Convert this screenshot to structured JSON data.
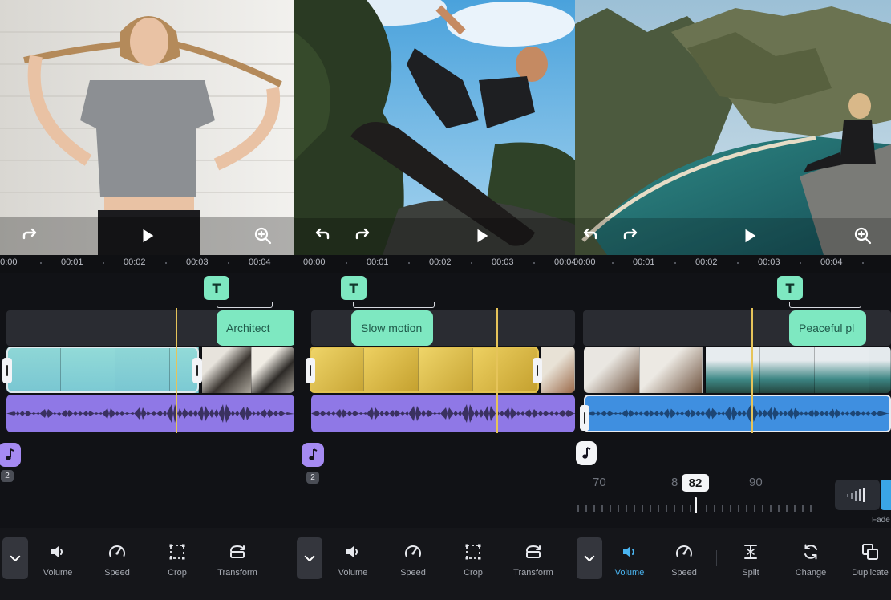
{
  "panels": [
    {
      "ruler": [
        "00:00",
        "00:01",
        "00:02",
        "00:03",
        "00:04"
      ],
      "text_clip": "Architect",
      "note_count": "2",
      "tools": [
        "Volume",
        "Speed",
        "Crop",
        "Transform"
      ]
    },
    {
      "ruler": [
        "00:00",
        "00:01",
        "00:02",
        "00:03",
        "00:04"
      ],
      "text_clip": "Slow motion",
      "note_count": "2",
      "tools": [
        "Volume",
        "Speed",
        "Crop",
        "Transform"
      ]
    },
    {
      "ruler": [
        "00:00",
        "00:01",
        "00:02",
        "00:03",
        "00:04"
      ],
      "text_clip": "Peaceful pl",
      "volume": {
        "current": "82",
        "scale": [
          "70",
          "8",
          "90"
        ],
        "fade_label": "Fade"
      },
      "tools": [
        "Volume",
        "Speed",
        "Split",
        "Change",
        "Duplicate"
      ]
    }
  ],
  "marker_glyph": "T",
  "colors": {
    "text_clip": "#7ee8c1",
    "audio_purple": "#8f78e6",
    "audio_blue": "#3f8fe0",
    "playhead": "#e6c45a",
    "active_tool": "#4ab4f0",
    "selection_yellow": "#e3c24f"
  },
  "icons": [
    "redo-icon",
    "undo-icon",
    "play-icon",
    "zoom-in-icon",
    "chevron-down-icon",
    "volume-icon",
    "speed-icon",
    "crop-icon",
    "transform-icon",
    "split-icon",
    "change-icon",
    "duplicate-icon",
    "music-note-icon"
  ]
}
